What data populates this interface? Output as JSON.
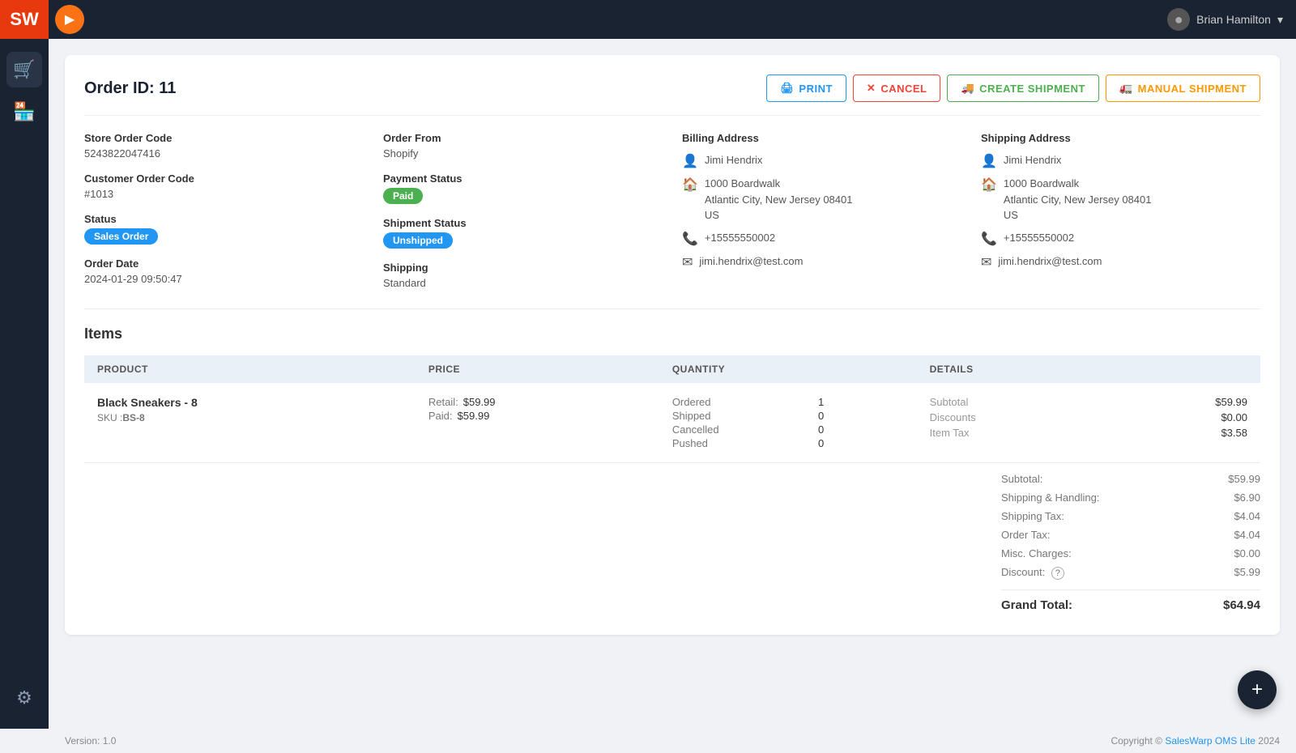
{
  "app": {
    "logo_text": "SW",
    "version_label": "Version: 1.0",
    "copyright_text": "Copyright ©",
    "copyright_link": "SalesWarp OMS Lite",
    "copyright_year": "2024"
  },
  "user": {
    "name": "Brian Hamilton",
    "chevron": "▾"
  },
  "sidebar": {
    "items": [
      {
        "id": "cart",
        "icon": "🛒",
        "label": "Orders"
      },
      {
        "id": "store",
        "icon": "🏪",
        "label": "Store"
      }
    ],
    "bottom_items": [
      {
        "id": "settings",
        "icon": "⚙",
        "label": "Settings"
      }
    ]
  },
  "order": {
    "title": "Order ID: 11",
    "actions": {
      "print": "PRINT",
      "cancel": "CANCEL",
      "create_shipment": "CREATE SHIPMENT",
      "manual_shipment": "MANUAL SHIPMENT"
    },
    "store_order_code_label": "Store Order Code",
    "store_order_code": "5243822047416",
    "customer_order_code_label": "Customer Order Code",
    "customer_order_code": "#1013",
    "status_label": "Status",
    "status_value": "Sales Order",
    "order_date_label": "Order Date",
    "order_date": "2024-01-29 09:50:47",
    "order_from_label": "Order From",
    "order_from": "Shopify",
    "payment_status_label": "Payment Status",
    "payment_status": "Paid",
    "shipment_status_label": "Shipment Status",
    "shipment_status": "Unshipped",
    "shipping_label": "Shipping",
    "shipping_value": "Standard",
    "billing_address": {
      "label": "Billing Address",
      "name": "Jimi Hendrix",
      "street": "1000 Boardwalk",
      "city_state_zip": "Atlantic City, New Jersey 08401",
      "country": "US",
      "phone": "+15555550002",
      "email": "jimi.hendrix@test.com"
    },
    "shipping_address": {
      "label": "Shipping Address",
      "name": "Jimi Hendrix",
      "street": "1000 Boardwalk",
      "city_state_zip": "Atlantic City, New Jersey 08401",
      "country": "US",
      "phone": "+15555550002",
      "email": "jimi.hendrix@test.com"
    }
  },
  "items": {
    "section_title": "Items",
    "columns": {
      "product": "PRODUCT",
      "price": "PRICE",
      "quantity": "QUANTITY",
      "details": "DETAILS"
    },
    "rows": [
      {
        "name": "Black Sneakers - 8",
        "sku_label": "SKU :",
        "sku": "BS-8",
        "retail_label": "Retail:",
        "retail_price": "$59.99",
        "paid_label": "Paid:",
        "paid_price": "$59.99",
        "ordered_label": "Ordered",
        "ordered": "1",
        "shipped_label": "Shipped",
        "shipped": "0",
        "cancelled_label": "Cancelled",
        "cancelled": "0",
        "pushed_label": "Pushed",
        "pushed": "0",
        "subtotal_label": "Subtotal",
        "subtotal": "$59.99",
        "discounts_label": "Discounts",
        "discounts": "$0.00",
        "item_tax_label": "Item Tax",
        "item_tax": "$3.58"
      }
    ]
  },
  "totals": {
    "subtotal_label": "Subtotal:",
    "subtotal": "$59.99",
    "shipping_handling_label": "Shipping & Handling:",
    "shipping_handling": "$6.90",
    "shipping_tax_label": "Shipping Tax:",
    "shipping_tax": "$4.04",
    "order_tax_label": "Order Tax:",
    "order_tax": "$4.04",
    "misc_charges_label": "Misc. Charges:",
    "misc_charges": "$0.00",
    "discount_label": "Discount:",
    "discount": "$5.99",
    "grand_total_label": "Grand Total:",
    "grand_total": "$64.94"
  },
  "fab": {
    "icon": "+"
  }
}
